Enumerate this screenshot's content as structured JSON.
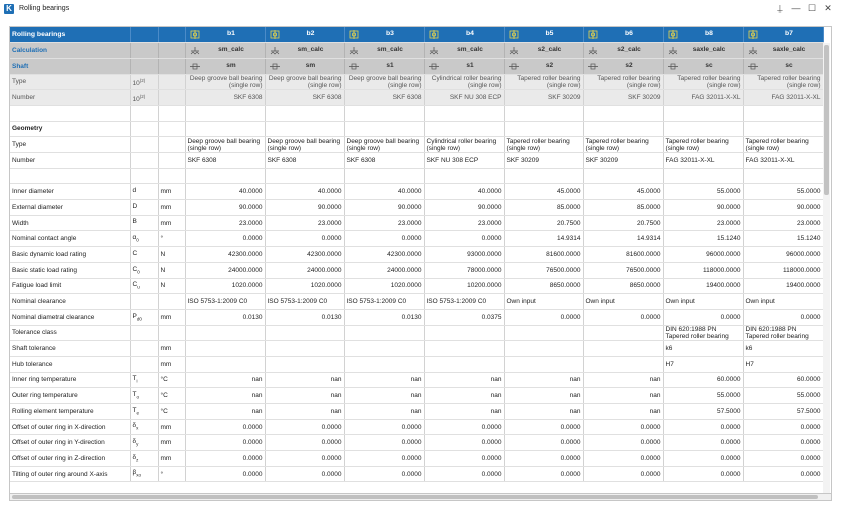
{
  "window": {
    "app_icon_letter": "K",
    "title": "Rolling bearings",
    "controls": {
      "pin": "⍊",
      "minimize": "—",
      "maximize": "☐",
      "close": "✕"
    }
  },
  "colors": {
    "header_blue": "#1f6fb5",
    "gray_row": "#c9c9c9",
    "light_gray_row": "#eaeaea"
  },
  "header": {
    "label": "Rolling bearings",
    "columns": [
      "b1",
      "b2",
      "b3",
      "b4",
      "b5",
      "b6",
      "b8",
      "b7"
    ]
  },
  "calculation": {
    "label": "Calculation",
    "values": [
      "sm_calc",
      "sm_calc",
      "sm_calc",
      "sm_calc",
      "s2_calc",
      "s2_calc",
      "saxle_calc",
      "saxle_calc"
    ]
  },
  "shaft": {
    "label": "Shaft",
    "values": [
      "sm",
      "sm",
      "s1",
      "s1",
      "s2",
      "s2",
      "sc",
      "sc"
    ]
  },
  "top_rows": [
    {
      "label": "Type",
      "unit_prefix": "10",
      "unit_sup": "(2)",
      "values": [
        "Deep groove ball bearing (single row)",
        "Deep groove ball bearing (single row)",
        "Deep groove ball bearing (single row)",
        "Cylindrical roller bearing (single row)",
        "Tapered roller bearing (single row)",
        "Tapered roller bearing (single row)",
        "Tapered roller bearing (single row)",
        "Tapered roller bearing (single row)"
      ]
    },
    {
      "label": "Number",
      "unit_prefix": "10",
      "unit_sup": "(2)",
      "values": [
        "SKF 6308",
        "SKF 6308",
        "SKF 6308",
        "SKF NU 308 ECP",
        "SKF 30209",
        "SKF 30209",
        "FAG 32011-X-XL",
        "FAG 32011-X-XL"
      ]
    }
  ],
  "geometry": {
    "label": "Geometry"
  },
  "geo_text_rows": [
    {
      "label": "Type",
      "values": [
        "Deep groove ball bearing (single row)",
        "Deep groove ball bearing (single row)",
        "Deep groove ball bearing (single row)",
        "Cylindrical roller bearing (single row)",
        "Tapered roller bearing (single row)",
        "Tapered roller bearing (single row)",
        "Tapered roller bearing (single row)",
        "Tapered roller bearing (single row)"
      ]
    },
    {
      "label": "Number",
      "values": [
        "SKF 6308",
        "SKF 6308",
        "SKF 6308",
        "SKF NU 308 ECP",
        "SKF 30209",
        "SKF 30209",
        "FAG 32011-X-XL",
        "FAG 32011-X-XL"
      ]
    }
  ],
  "rows": [
    {
      "label": "Inner diameter",
      "sym": "d",
      "sub": "",
      "unit": "mm",
      "align": "num",
      "values": [
        "40.0000",
        "40.0000",
        "40.0000",
        "40.0000",
        "45.0000",
        "45.0000",
        "55.0000",
        "55.0000"
      ]
    },
    {
      "label": "External diameter",
      "sym": "D",
      "sub": "",
      "unit": "mm",
      "align": "num",
      "values": [
        "90.0000",
        "90.0000",
        "90.0000",
        "90.0000",
        "85.0000",
        "85.0000",
        "90.0000",
        "90.0000"
      ]
    },
    {
      "label": "Width",
      "sym": "B",
      "sub": "",
      "unit": "mm",
      "align": "num",
      "values": [
        "23.0000",
        "23.0000",
        "23.0000",
        "23.0000",
        "20.7500",
        "20.7500",
        "23.0000",
        "23.0000"
      ]
    },
    {
      "label": "Nominal contact angle",
      "sym": "α",
      "sub": "0",
      "unit": "°",
      "align": "num",
      "values": [
        "0.0000",
        "0.0000",
        "0.0000",
        "0.0000",
        "14.9314",
        "14.9314",
        "15.1240",
        "15.1240"
      ]
    },
    {
      "label": "Basic dynamic load rating",
      "sym": "C",
      "sub": "",
      "unit": "N",
      "align": "num",
      "values": [
        "42300.0000",
        "42300.0000",
        "42300.0000",
        "93000.0000",
        "81600.0000",
        "81600.0000",
        "96000.0000",
        "96000.0000"
      ]
    },
    {
      "label": "Basic static load rating",
      "sym": "C",
      "sub": "0",
      "unit": "N",
      "align": "num",
      "values": [
        "24000.0000",
        "24000.0000",
        "24000.0000",
        "78000.0000",
        "76500.0000",
        "76500.0000",
        "118000.0000",
        "118000.0000"
      ]
    },
    {
      "label": "Fatigue load limit",
      "sym": "C",
      "sub": "u",
      "unit": "N",
      "align": "num",
      "values": [
        "1020.0000",
        "1020.0000",
        "1020.0000",
        "10200.0000",
        "8650.0000",
        "8650.0000",
        "19400.0000",
        "19400.0000"
      ]
    },
    {
      "label": "Nominal clearance",
      "sym": "",
      "sub": "",
      "unit": "",
      "align": "left",
      "values": [
        "ISO 5753-1:2009 C0",
        "ISO 5753-1:2009 C0",
        "ISO 5753-1:2009 C0",
        "ISO 5753-1:2009 C0",
        "Own input",
        "Own input",
        "Own input",
        "Own input"
      ]
    },
    {
      "label": "Nominal diametral clearance",
      "sym": "P",
      "sub": "d0",
      "unit": "mm",
      "align": "num",
      "values": [
        "0.0130",
        "0.0130",
        "0.0130",
        "0.0375",
        "0.0000",
        "0.0000",
        "0.0000",
        "0.0000"
      ]
    },
    {
      "label": "Tolerance class",
      "sym": "",
      "sub": "",
      "unit": "",
      "align": "wrap",
      "values": [
        "",
        "",
        "",
        "",
        "",
        "",
        "DIN 620:1988 PN Tapered roller bearing",
        "DIN 620:1988 PN Tapered roller bearing"
      ]
    },
    {
      "label": "Shaft tolerance",
      "sym": "",
      "sub": "",
      "unit": "mm",
      "align": "left",
      "values": [
        "",
        "",
        "",
        "",
        "",
        "",
        "k6",
        "k6"
      ]
    },
    {
      "label": "Hub tolerance",
      "sym": "",
      "sub": "",
      "unit": "mm",
      "align": "left",
      "values": [
        "",
        "",
        "",
        "",
        "",
        "",
        "H7",
        "H7"
      ]
    },
    {
      "label": "Inner ring temperature",
      "sym": "T",
      "sub": "i",
      "unit": "°C",
      "align": "num",
      "values": [
        "nan",
        "nan",
        "nan",
        "nan",
        "nan",
        "nan",
        "60.0000",
        "60.0000"
      ]
    },
    {
      "label": "Outer ring temperature",
      "sym": "T",
      "sub": "o",
      "unit": "°C",
      "align": "num",
      "values": [
        "nan",
        "nan",
        "nan",
        "nan",
        "nan",
        "nan",
        "55.0000",
        "55.0000"
      ]
    },
    {
      "label": "Rolling element temperature",
      "sym": "T",
      "sub": "e",
      "unit": "°C",
      "align": "num",
      "values": [
        "nan",
        "nan",
        "nan",
        "nan",
        "nan",
        "nan",
        "57.5000",
        "57.5000"
      ]
    },
    {
      "label": "Offset of outer ring in X-direction",
      "sym": "δ",
      "sub": "x",
      "unit": "mm",
      "align": "num",
      "values": [
        "0.0000",
        "0.0000",
        "0.0000",
        "0.0000",
        "0.0000",
        "0.0000",
        "0.0000",
        "0.0000"
      ]
    },
    {
      "label": "Offset of outer ring in Y-direction",
      "sym": "δ",
      "sub": "y",
      "unit": "mm",
      "align": "num",
      "values": [
        "0.0000",
        "0.0000",
        "0.0000",
        "0.0000",
        "0.0000",
        "0.0000",
        "0.0000",
        "0.0000"
      ]
    },
    {
      "label": "Offset of outer ring in Z-direction",
      "sym": "δ",
      "sub": "z",
      "unit": "mm",
      "align": "num",
      "values": [
        "0.0000",
        "0.0000",
        "0.0000",
        "0.0000",
        "0.0000",
        "0.0000",
        "0.0000",
        "0.0000"
      ]
    },
    {
      "label": "Tilting of outer ring around X-axis",
      "sym": "β",
      "sub": "xo",
      "unit": "°",
      "align": "num",
      "values": [
        "0.0000",
        "0.0000",
        "0.0000",
        "0.0000",
        "0.0000",
        "0.0000",
        "0.0000",
        "0.0000"
      ]
    }
  ]
}
